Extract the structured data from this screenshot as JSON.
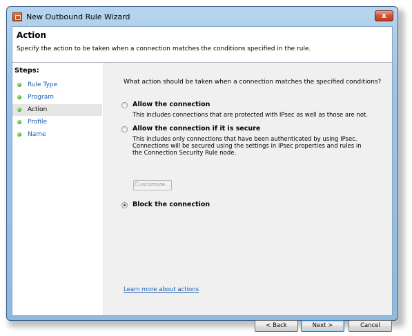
{
  "window": {
    "title": "New Outbound Rule Wizard",
    "close_label": "x"
  },
  "header": {
    "title": "Action",
    "description": "Specify the action to be taken when a connection matches the conditions specified in the rule."
  },
  "steps": {
    "title": "Steps:",
    "items": [
      {
        "label": "Rule Type"
      },
      {
        "label": "Program"
      },
      {
        "label": "Action"
      },
      {
        "label": "Profile"
      },
      {
        "label": "Name"
      }
    ]
  },
  "main": {
    "question": "What action should be taken when a connection matches the specified conditions?",
    "options": [
      {
        "label": "Allow the connection",
        "description": "This includes connections that are protected with IPsec as well as those are not.",
        "selected": false
      },
      {
        "label": "Allow the connection if it is secure",
        "description": "This includes only connections that have been authenticated by using IPsec.  Connections will be secured using the settings in IPsec properties and rules in the Connection Security Rule node.",
        "selected": false
      },
      {
        "label": "Block the connection",
        "description": "",
        "selected": true
      }
    ],
    "customize_label": "Customize...",
    "learn_more_link": "Learn more about actions"
  },
  "buttons": {
    "back": "< Back",
    "next": "Next >",
    "cancel": "Cancel"
  }
}
